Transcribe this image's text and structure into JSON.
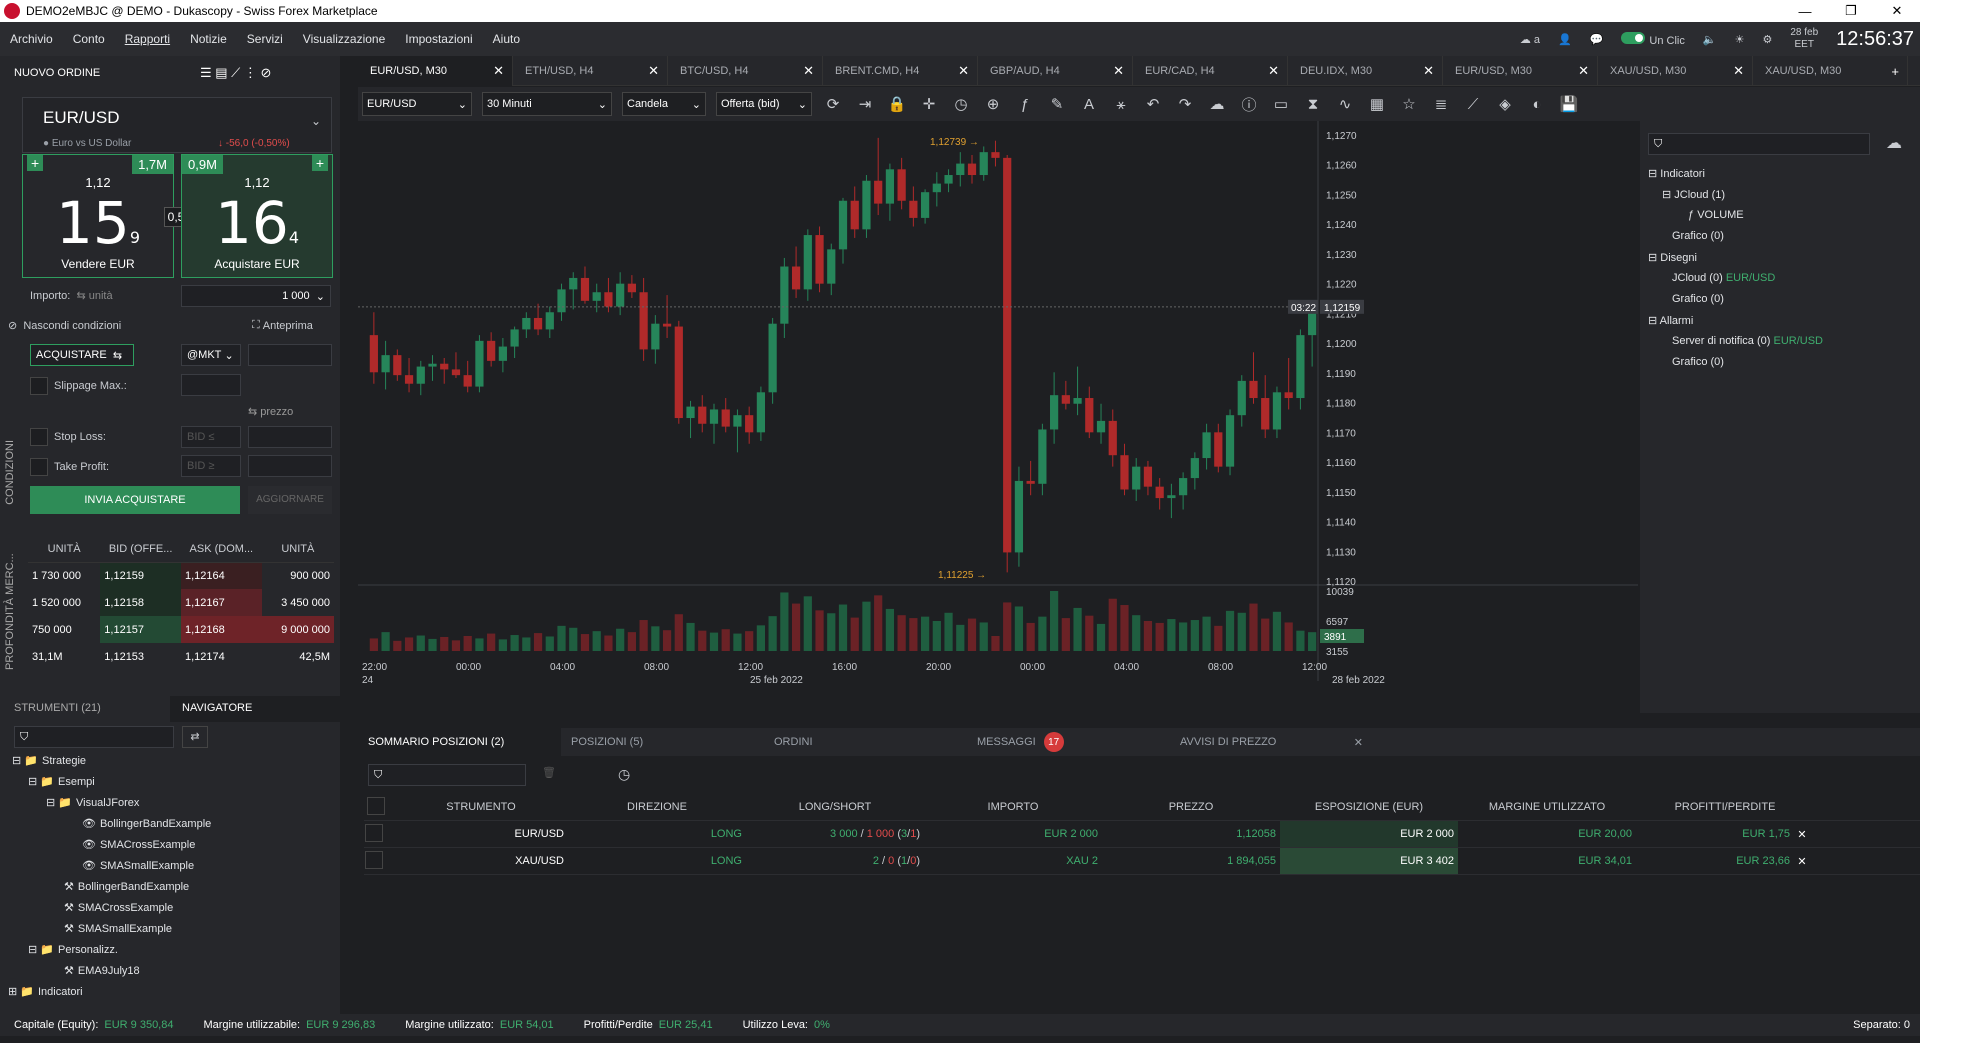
{
  "window": {
    "title": "DEMO2eMBJC @ DEMO - Dukascopy - Swiss Forex Marketplace",
    "min": "—",
    "max": "❐",
    "close": "✕"
  },
  "menu": [
    "Archivio",
    "Conto",
    "Rapporti",
    "Notizie",
    "Servizi",
    "Visualizzazione",
    "Impostazioni",
    "Aiuto"
  ],
  "menu_right": {
    "oneclick": "Un Clic",
    "date": "28 feb",
    "tz": "EET",
    "time": "12:56:37",
    "a": "a"
  },
  "order": {
    "header": "NUOVO ORDINE",
    "symbol": "EUR/USD",
    "desc": "Euro vs US Dollar",
    "change": "↓ -56,0 (-0,50%)",
    "sell": {
      "vol": "1,7M",
      "pre": "1,12",
      "big": "15",
      "pip": "9",
      "label": "Vendere EUR"
    },
    "buy": {
      "vol": "0,9M",
      "pre": "1,12",
      "big": "16",
      "pip": "4",
      "label": "Acquistare EUR"
    },
    "spread": "0,5",
    "amount_label": "Importo:",
    "units": "⇆ unità",
    "amount": "1 000",
    "hide": "Nascondi condizioni",
    "preview": "Anteprima",
    "side": "ACQUISTARE",
    "mkt": "@MKT",
    "slippage": "Slippage Max.:",
    "price": "⇆ prezzo",
    "stoploss": "Stop Loss:",
    "takeprofit": "Take Profit:",
    "bid_le": "BID ≤",
    "bid_ge": "BID ≥",
    "submit": "INVIA ACQUISTARE",
    "update": "AGGIORNARE",
    "conditions": "CONDIZIONI"
  },
  "depth": {
    "vlabel": "PROFONDITÀ MERC...",
    "headers": [
      "UNITÀ",
      "BID (OFFE...",
      "ASK (DOM...",
      "UNITÀ"
    ],
    "rows": [
      [
        "1 730 000",
        "1,12159",
        "1,12164",
        "900 000"
      ],
      [
        "1 520 000",
        "1,12158",
        "1,12167",
        "3 450 000"
      ],
      [
        "750 000",
        "1,12157",
        "1,12168",
        "9 000 000"
      ]
    ],
    "footer": [
      "31,1M",
      "1,12153",
      "1,12174",
      "42,5M"
    ]
  },
  "navigator": {
    "tabs": [
      "STRUMENTI (21)",
      "NAVIGATORE"
    ],
    "items": [
      "Strategie",
      "Esempi",
      "VisualJForex",
      "BollingerBandExample",
      "SMACrossExample",
      "SMASmallExample",
      "BollingerBandExample",
      "SMACrossExample",
      "SMASmallExample",
      "Personalizz.",
      "EMA9July18",
      "Indicatori"
    ]
  },
  "tabs": [
    "EUR/USD, M30",
    "ETH/USD, H4",
    "BTC/USD, H4",
    "BRENT.CMD, H4",
    "GBP/AUD, H4",
    "EUR/CAD, H4",
    "DEU.IDX, M30",
    "EUR/USD, M30",
    "XAU/USD, M30",
    "XAU/USD, M30"
  ],
  "toolbar": {
    "instrument": "EUR/USD",
    "period": "30 Minuti",
    "type": "Candela",
    "side": "Offerta (bid)"
  },
  "chart_data": {
    "type": "candlestick",
    "title": "EUR/USD, M30",
    "price_axis": [
      "1,1270",
      "1,1260",
      "1,1250",
      "1,1240",
      "1,1230",
      "1,1220",
      "1,1210",
      "1,1200",
      "1,1190",
      "1,1180",
      "1,1170",
      "1,1160",
      "1,1150",
      "1,1140",
      "1,1130",
      "1,1120"
    ],
    "volume_axis": [
      "10039",
      "6597",
      "3155"
    ],
    "current_price": "1,12159",
    "countdown": "03:22",
    "current_volume": "3891",
    "high_label": "1,12739",
    "low_label": "1,11225",
    "time_axis": [
      "22:00",
      "00:00",
      "04:00",
      "08:00",
      "12:00",
      "16:00",
      "20:00",
      "00:00",
      "04:00",
      "08:00",
      "12:00"
    ],
    "date_axis": [
      "24",
      "25 feb 2022",
      "28 feb 2022"
    ],
    "candles": [
      [
        1.1206,
        1.1214,
        1.1189,
        1.1193
      ],
      [
        1.1193,
        1.1204,
        1.1187,
        1.1199
      ],
      [
        1.1199,
        1.1201,
        1.119,
        1.1192
      ],
      [
        1.1192,
        1.1198,
        1.1186,
        1.1189
      ],
      [
        1.1189,
        1.1197,
        1.1185,
        1.1195
      ],
      [
        1.1195,
        1.1199,
        1.119,
        1.1196
      ],
      [
        1.1196,
        1.1198,
        1.1189,
        1.1194
      ],
      [
        1.1194,
        1.12,
        1.1191,
        1.1192
      ],
      [
        1.1192,
        1.1197,
        1.1186,
        1.1188
      ],
      [
        1.1188,
        1.1206,
        1.1186,
        1.1204
      ],
      [
        1.1204,
        1.1207,
        1.1195,
        1.1197
      ],
      [
        1.1197,
        1.1205,
        1.1193,
        1.1202
      ],
      [
        1.1202,
        1.1209,
        1.1198,
        1.1208
      ],
      [
        1.1208,
        1.1214,
        1.1205,
        1.1212
      ],
      [
        1.1212,
        1.1217,
        1.1206,
        1.1208
      ],
      [
        1.1208,
        1.1216,
        1.1205,
        1.1214
      ],
      [
        1.1214,
        1.1224,
        1.1211,
        1.1222
      ],
      [
        1.1222,
        1.1228,
        1.1215,
        1.1226
      ],
      [
        1.1226,
        1.123,
        1.1217,
        1.1218
      ],
      [
        1.1218,
        1.1224,
        1.1214,
        1.1221
      ],
      [
        1.1221,
        1.1226,
        1.1214,
        1.1216
      ],
      [
        1.1216,
        1.1228,
        1.1213,
        1.1224
      ],
      [
        1.1224,
        1.1227,
        1.1219,
        1.1221
      ],
      [
        1.1221,
        1.1226,
        1.1197,
        1.1201
      ],
      [
        1.1201,
        1.1213,
        1.1196,
        1.121
      ],
      [
        1.121,
        1.122,
        1.1205,
        1.1209
      ],
      [
        1.1209,
        1.1211,
        1.1175,
        1.1177
      ],
      [
        1.1177,
        1.1183,
        1.117,
        1.1181
      ],
      [
        1.1181,
        1.1185,
        1.1172,
        1.1175
      ],
      [
        1.1175,
        1.1182,
        1.1168,
        1.118
      ],
      [
        1.118,
        1.1184,
        1.1172,
        1.1174
      ],
      [
        1.1174,
        1.118,
        1.1165,
        1.1178
      ],
      [
        1.1178,
        1.1181,
        1.1168,
        1.1172
      ],
      [
        1.1172,
        1.1188,
        1.1169,
        1.1186
      ],
      [
        1.1186,
        1.1212,
        1.1182,
        1.121
      ],
      [
        1.121,
        1.1233,
        1.1205,
        1.123
      ],
      [
        1.123,
        1.1237,
        1.1219,
        1.1222
      ],
      [
        1.1222,
        1.1243,
        1.1218,
        1.1241
      ],
      [
        1.1241,
        1.1244,
        1.1221,
        1.1224
      ],
      [
        1.1224,
        1.1238,
        1.122,
        1.1236
      ],
      [
        1.1236,
        1.1254,
        1.1231,
        1.1253
      ],
      [
        1.1253,
        1.1258,
        1.124,
        1.1243
      ],
      [
        1.1243,
        1.1262,
        1.124,
        1.126
      ],
      [
        1.126,
        1.1275,
        1.1248,
        1.1252
      ],
      [
        1.1252,
        1.1266,
        1.1246,
        1.1264
      ],
      [
        1.1264,
        1.1268,
        1.125,
        1.1253
      ],
      [
        1.1253,
        1.1258,
        1.1244,
        1.1247
      ],
      [
        1.1247,
        1.1257,
        1.1245,
        1.1256
      ],
      [
        1.1256,
        1.1263,
        1.1251,
        1.1259
      ],
      [
        1.1259,
        1.1264,
        1.1256,
        1.1262
      ],
      [
        1.1262,
        1.127,
        1.1258,
        1.1266
      ],
      [
        1.1266,
        1.1269,
        1.1259,
        1.1262
      ],
      [
        1.1262,
        1.1272,
        1.126,
        1.127
      ],
      [
        1.127,
        1.1274,
        1.1265,
        1.1268
      ],
      [
        1.1268,
        1.1269,
        1.1123,
        1.113
      ],
      [
        1.113,
        1.116,
        1.1125,
        1.1155
      ],
      [
        1.1155,
        1.1162,
        1.115,
        1.1154
      ],
      [
        1.1154,
        1.1175,
        1.115,
        1.1173
      ],
      [
        1.1173,
        1.1193,
        1.1168,
        1.1185
      ],
      [
        1.1185,
        1.119,
        1.118,
        1.1182
      ],
      [
        1.1182,
        1.1195,
        1.1178,
        1.1184
      ],
      [
        1.1184,
        1.1188,
        1.117,
        1.1172
      ],
      [
        1.1172,
        1.1182,
        1.1168,
        1.1176
      ],
      [
        1.1176,
        1.118,
        1.116,
        1.1164
      ],
      [
        1.1164,
        1.1168,
        1.115,
        1.1152
      ],
      [
        1.1152,
        1.1163,
        1.1148,
        1.116
      ],
      [
        1.116,
        1.1162,
        1.115,
        1.1153
      ],
      [
        1.1153,
        1.1156,
        1.1145,
        1.1149
      ],
      [
        1.1149,
        1.1154,
        1.1142,
        1.115
      ],
      [
        1.115,
        1.1158,
        1.1145,
        1.1156
      ],
      [
        1.1156,
        1.1165,
        1.1152,
        1.1163
      ],
      [
        1.1163,
        1.1175,
        1.1159,
        1.1172
      ],
      [
        1.1172,
        1.1175,
        1.1158,
        1.116
      ],
      [
        1.116,
        1.118,
        1.1157,
        1.1178
      ],
      [
        1.1178,
        1.1192,
        1.1174,
        1.119
      ],
      [
        1.119,
        1.12,
        1.1182,
        1.1184
      ],
      [
        1.1184,
        1.1192,
        1.117,
        1.1173
      ],
      [
        1.1173,
        1.1188,
        1.117,
        1.1186
      ],
      [
        1.1186,
        1.1198,
        1.118,
        1.1184
      ],
      [
        1.1184,
        1.1208,
        1.118,
        1.1206
      ],
      [
        1.1206,
        1.1218,
        1.1195,
        1.1216
      ]
    ],
    "volumes": [
      2600,
      3900,
      2100,
      2800,
      3200,
      2500,
      2900,
      2200,
      3100,
      2600,
      3600,
      2400,
      3300,
      2800,
      3700,
      3000,
      5200,
      4800,
      3500,
      4100,
      3200,
      4600,
      3900,
      6400,
      5100,
      4300,
      7600,
      5800,
      4200,
      3800,
      4500,
      3600,
      4100,
      5300,
      7200,
      12100,
      9800,
      11300,
      8400,
      7800,
      9600,
      6900,
      10200,
      11500,
      8700,
      7400,
      6800,
      7100,
      6200,
      7900,
      5400,
      6700,
      5900,
      3100,
      10039,
      9200,
      5800,
      7100,
      12400,
      6800,
      8900,
      7300,
      5600,
      10800,
      9500,
      7400,
      6200,
      5800,
      6600,
      5900,
      6400,
      7100,
      5200,
      8300,
      7900,
      9800,
      6700,
      8100,
      5900,
      4200,
      3891
    ],
    "ylim": [
      1.112,
      1.1276
    ]
  },
  "rpanel": {
    "items": [
      "Indicatori",
      "JCloud (1)",
      "VOLUME",
      "Grafico (0)",
      "Disegni",
      "JCloud (0)",
      "Grafico (0)",
      "Allarmi",
      "Server di notifica (0)",
      "Grafico (0)"
    ],
    "tag": "EUR/USD"
  },
  "bottom": {
    "tabs": [
      "SOMMARIO POSIZIONI (2)",
      "POSIZIONI (5)",
      "ORDINI",
      "MESSAGGI",
      "AVVISI DI PREZZO"
    ],
    "msg_count": "17",
    "headers": [
      "STRUMENTO",
      "DIREZIONE",
      "LONG/SHORT",
      "IMPORTO",
      "PREZZO",
      "ESPOSIZIONE (EUR)",
      "MARGINE UTILIZZATO",
      "PROFITTI/PERDITE"
    ],
    "rows": [
      {
        "sym": "EUR/USD",
        "dir": "LONG",
        "ls_long": "3 000",
        "ls_short": "1 000",
        "ls_count": "3",
        "ls_count2": "1",
        "amount": "EUR 2 000",
        "price": "1,12058",
        "exposure": "EUR 2 000",
        "margin": "EUR 20,00",
        "pl": "EUR 1,75"
      },
      {
        "sym": "XAU/USD",
        "dir": "LONG",
        "ls_long": "2",
        "ls_short": "0",
        "ls_count": "1",
        "ls_count2": "0",
        "amount": "XAU 2",
        "price": "1 894,055",
        "exposure": "EUR 3 402",
        "margin": "EUR 34,01",
        "pl": "EUR 23,66"
      }
    ]
  },
  "status": {
    "equity_k": "Capitale (Equity):",
    "equity": "EUR 9 350,84",
    "free_k": "Margine utilizzabile:",
    "free": "EUR 9 296,83",
    "used_k": "Margine utilizzato:",
    "used": "EUR 54,01",
    "pl_k": "Profitti/Perdite",
    "pl": "EUR 25,41",
    "lev_k": "Utilizzo Leva:",
    "lev": "0%",
    "sep": "Separato: 0"
  },
  "colors": {
    "up": "#26855a",
    "down": "#b02a2a",
    "accent": "#2e9e5f"
  }
}
